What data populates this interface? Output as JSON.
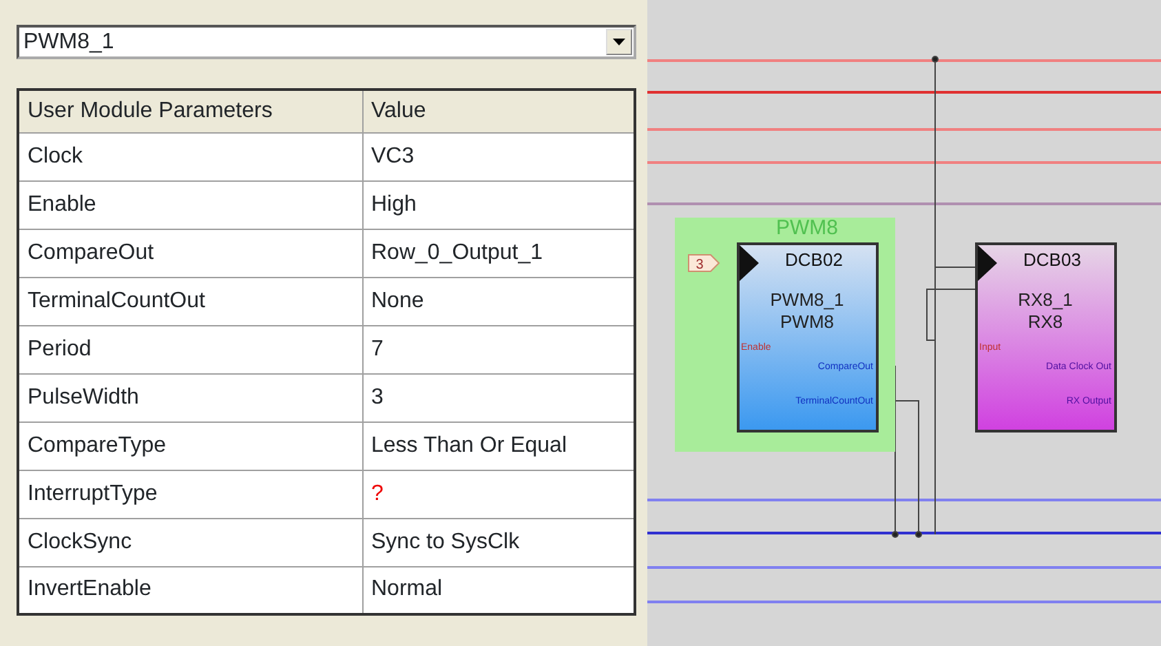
{
  "module_selector": {
    "value": "PWM8_1"
  },
  "parameters": {
    "columns": [
      "User Module Parameters",
      "Value"
    ],
    "rows": [
      {
        "name": "Clock",
        "value": "VC3",
        "invalid": false
      },
      {
        "name": "Enable",
        "value": "High",
        "invalid": false
      },
      {
        "name": "CompareOut",
        "value": "Row_0_Output_1",
        "invalid": false
      },
      {
        "name": "TerminalCountOut",
        "value": "None",
        "invalid": false
      },
      {
        "name": "Period",
        "value": "7",
        "invalid": false
      },
      {
        "name": "PulseWidth",
        "value": "3",
        "invalid": false
      },
      {
        "name": "CompareType",
        "value": "Less Than Or Equal",
        "invalid": false
      },
      {
        "name": "InterruptType",
        "value": "?",
        "invalid": true
      },
      {
        "name": "ClockSync",
        "value": "Sync to SysClk",
        "invalid": false
      },
      {
        "name": "InvertEnable",
        "value": "Normal",
        "invalid": false
      }
    ]
  },
  "diagram": {
    "blocks": [
      {
        "kind": "pwm",
        "selected": true,
        "title": "PWM8",
        "clock_tag": "3",
        "slot": "DCB02",
        "instance": "PWM8_1",
        "module": "PWM8",
        "input": "Enable",
        "outputs": [
          "CompareOut",
          "TerminalCountOut"
        ]
      },
      {
        "kind": "rx",
        "selected": false,
        "slot": "DCB03",
        "instance": "RX8_1",
        "module": "RX8",
        "input": "Input",
        "outputs": [
          "Data Clock Out",
          "RX Output"
        ]
      }
    ]
  }
}
